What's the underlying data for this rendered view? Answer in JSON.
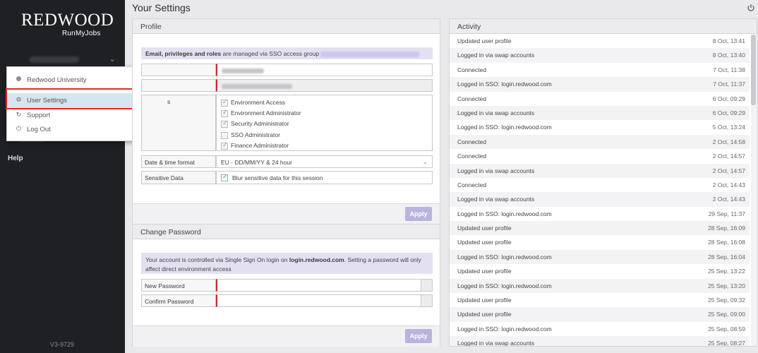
{
  "sidebar": {
    "logo": {
      "line1": "REDWOOD",
      "line2": "RunMyJobs"
    },
    "help": "Help",
    "version": "V3-9729"
  },
  "menu": {
    "items": [
      {
        "label": "Redwood University",
        "icon": "dot-icon"
      },
      {
        "label": "User Settings",
        "icon": "gear-icon"
      },
      {
        "label": "Support",
        "icon": "support-icon"
      },
      {
        "label": "Log Out",
        "icon": "power-icon"
      }
    ]
  },
  "header": {
    "title": "Your Settings"
  },
  "profile": {
    "title": "Profile",
    "sso_notice_bold": "Email, privileges and roles",
    "sso_notice_rest": " are managed via SSO access group",
    "permissions": [
      {
        "label": "Environment Access",
        "checked": true
      },
      {
        "label": "Environment Administrator",
        "checked": true
      },
      {
        "label": "Security Administrator",
        "checked": true
      },
      {
        "label": "SSO Administrator",
        "checked": false
      },
      {
        "label": "Finance Administrator",
        "checked": true
      }
    ],
    "partial_label": "s",
    "date_label": "Date & time format",
    "date_value": "EU - DD/MM/YY & 24 hour",
    "sensitive_label": "Sensitive Data",
    "sensitive_value": "Blur sensitive data for this session",
    "apply": "Apply"
  },
  "change_password": {
    "title": "Change Password",
    "notice_pre": "Your account is controlled via Single Sign On login on ",
    "notice_bold": "login.redwood.com",
    "notice_post": ". Setting a password will only affect direct environment access",
    "new_label": "New Password",
    "confirm_label": "Confirm Password",
    "apply": "Apply"
  },
  "activity": {
    "title": "Activity",
    "rows": [
      {
        "desc": "Updated user profile",
        "time": "8 Oct, 13:41"
      },
      {
        "desc": "Logged in via swap accounts",
        "time": "8 Oct, 13:40"
      },
      {
        "desc": "Connected",
        "time": "7 Oct, 11:38"
      },
      {
        "desc": "Logged in SSO: login.redwood.com",
        "time": "7 Oct, 11:37"
      },
      {
        "desc": "Connected",
        "time": "6 Oct, 09:29"
      },
      {
        "desc": "Logged in via swap accounts",
        "time": "6 Oct, 09:29"
      },
      {
        "desc": "Logged in SSO: login.redwood.com",
        "time": "5 Oct, 13:24"
      },
      {
        "desc": "Connected",
        "time": "2 Oct, 14:58"
      },
      {
        "desc": "Connected",
        "time": "2 Oct, 14:57"
      },
      {
        "desc": "Logged in via swap accounts",
        "time": "2 Oct, 14:57"
      },
      {
        "desc": "Connected",
        "time": "2 Oct, 14:43"
      },
      {
        "desc": "Logged in via swap accounts",
        "time": "2 Oct, 14:43"
      },
      {
        "desc": "Logged in SSO: login.redwood.com",
        "time": "29 Sep, 11:37"
      },
      {
        "desc": "Updated user profile",
        "time": "28 Sep, 16:09"
      },
      {
        "desc": "Updated user profile",
        "time": "28 Sep, 16:08"
      },
      {
        "desc": "Logged in SSO: login.redwood.com",
        "time": "28 Sep, 16:04"
      },
      {
        "desc": "Updated user profile",
        "time": "25 Sep, 13:22"
      },
      {
        "desc": "Logged in SSO: login.redwood.com",
        "time": "25 Sep, 13:20"
      },
      {
        "desc": "Updated user profile",
        "time": "25 Sep, 09:32"
      },
      {
        "desc": "Updated user profile",
        "time": "25 Sep, 09:00"
      },
      {
        "desc": "Logged in SSO: login.redwood.com",
        "time": "25 Sep, 08:59"
      },
      {
        "desc": "Logged in via swap accounts",
        "time": "25 Sep, 08:27"
      }
    ]
  },
  "colors": {
    "sidebar_bg": "#1f2024",
    "highlight": "#e0282b",
    "apply_btn": "#b8b4dc",
    "notice_bg": "#e3e1f1"
  }
}
